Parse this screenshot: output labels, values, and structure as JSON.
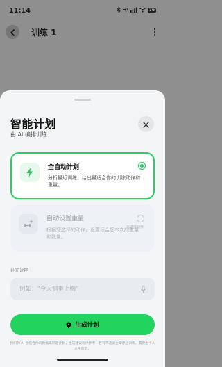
{
  "status_bar": {
    "time": "11:14",
    "icons": [
      "bluetooth-icon",
      "mute-icon",
      "cellular-icon",
      "wifi-icon"
    ],
    "battery": "76"
  },
  "header": {
    "back_icon": "chevron-left-icon",
    "title": "训练 1",
    "more_icon": "more-vertical-icon"
  },
  "sheet": {
    "title": "智能计划",
    "subtitle": "由 AI 编排训练",
    "close_icon": "close-icon",
    "options": [
      {
        "icon": "lightning-icon",
        "name": "全自动计划",
        "description": "分析最近训练，给出最适合你的训练动作和重量。",
        "selected": true
      },
      {
        "icon": "sparkle-dumbbell-icon",
        "name": "自动设置重量",
        "description": "根据您选择的动作，设置适合您本次的重量和数量。",
        "tag": "未选择动作",
        "selected": false,
        "disabled": true
      }
    ],
    "notes_label": "补充说明",
    "notes_placeholder": "例如：“今天侧重上胸”",
    "mic_icon": "mic-icon",
    "generate_label": "生成计划",
    "generate_icon": "location-pin-icon",
    "disclaimer": "我们的 AI 会结合你的数据来制定计划，生成建议仅供参考，若有不适请立即停止训练，需要由个人水平而定。"
  },
  "colors": {
    "accent": "#22d45e",
    "sheet_bg": "#f3f5f6",
    "overlay": "#8f8f8f"
  }
}
